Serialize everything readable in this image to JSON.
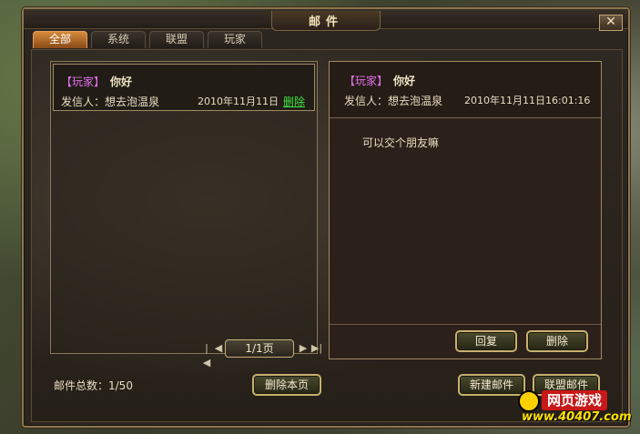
{
  "window": {
    "title": "邮件",
    "close_label": "✕"
  },
  "tabs": [
    {
      "label": "全部",
      "active": true
    },
    {
      "label": "系统",
      "active": false
    },
    {
      "label": "联盟",
      "active": false
    },
    {
      "label": "玩家",
      "active": false
    }
  ],
  "mail_list": {
    "items": [
      {
        "tag": "【玩家】",
        "subject": "你好",
        "sender_label": "发信人：想去泡温泉",
        "date": "2010年11月11日",
        "delete_label": "删除"
      }
    ],
    "pager": {
      "first": "|◀",
      "prev": "◀",
      "page_text": "1/1页",
      "next": "▶",
      "last": "▶|"
    }
  },
  "reader": {
    "tag": "【玩家】",
    "subject": "你好",
    "sender_label": "发信人：想去泡温泉",
    "datetime": "2010年11月11日16:01:16",
    "body": "可以交个朋友嘛",
    "reply_label": "回复",
    "delete_label": "删除"
  },
  "footer": {
    "total_text": "邮件总数：1/50",
    "delete_page_label": "删除本页",
    "new_mail_label": "新建邮件",
    "alliance_mail_label": "联盟邮件"
  },
  "watermark": {
    "top": "网页游戏",
    "bottom": "www.40407.com"
  },
  "colors": {
    "accent_tab": "#d68a3a",
    "tag": "#e070e8",
    "link_delete": "#40e040",
    "button_border": "#c8b070"
  }
}
